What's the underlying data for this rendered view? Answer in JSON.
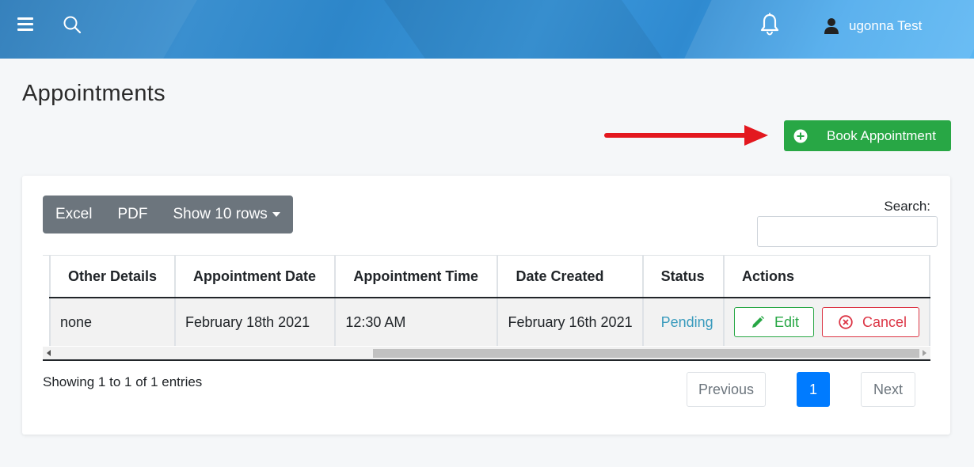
{
  "header": {
    "user_name": "ugonna Test",
    "icons": [
      "menu-icon",
      "search-icon",
      "bell-icon",
      "user-icon"
    ],
    "accent": "#3a8fcf"
  },
  "page": {
    "title": "Appointments",
    "book_button": "Book Appointment",
    "book_button_color": "#28a745"
  },
  "toolbar": {
    "excel": "Excel",
    "pdf": "PDF",
    "show_rows": "Show 10 rows"
  },
  "search": {
    "label": "Search:",
    "value": ""
  },
  "table": {
    "headers": [
      "Other Details",
      "Appointment Date",
      "Appointment Time",
      "Date Created",
      "Status",
      "Actions"
    ],
    "rows": [
      {
        "other_details": "none",
        "appointment_date": "February 18th 2021",
        "appointment_time": "12:30 AM",
        "date_created": "February 16th 2021",
        "status": "Pending",
        "edit_label": "Edit",
        "cancel_label": "Cancel"
      }
    ]
  },
  "footer": {
    "info": "Showing 1 to 1 of 1 entries",
    "previous": "Previous",
    "page": "1",
    "next": "Next"
  }
}
